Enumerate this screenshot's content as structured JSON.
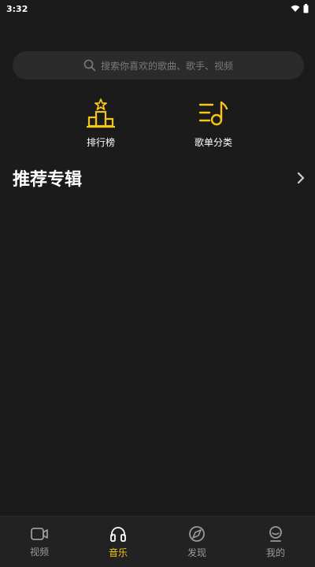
{
  "status_bar": {
    "time": "3:32"
  },
  "search": {
    "placeholder": "搜索你喜欢的歌曲、歌手、视频"
  },
  "shortcuts": [
    {
      "label": "排行榜",
      "icon": "podium-icon"
    },
    {
      "label": "歌单分类",
      "icon": "playlist-music-icon"
    }
  ],
  "section": {
    "title": "推荐专辑"
  },
  "bottom_nav": {
    "items": [
      {
        "label": "视频",
        "icon": "video-camera-icon",
        "active": false
      },
      {
        "label": "音乐",
        "icon": "headphones-icon",
        "active": true
      },
      {
        "label": "发现",
        "icon": "compass-icon",
        "active": false
      },
      {
        "label": "我的",
        "icon": "profile-icon",
        "active": false
      }
    ]
  },
  "colors": {
    "accent": "#f5c518",
    "background": "#1b1b1b",
    "inactive": "#9a9a9a"
  }
}
